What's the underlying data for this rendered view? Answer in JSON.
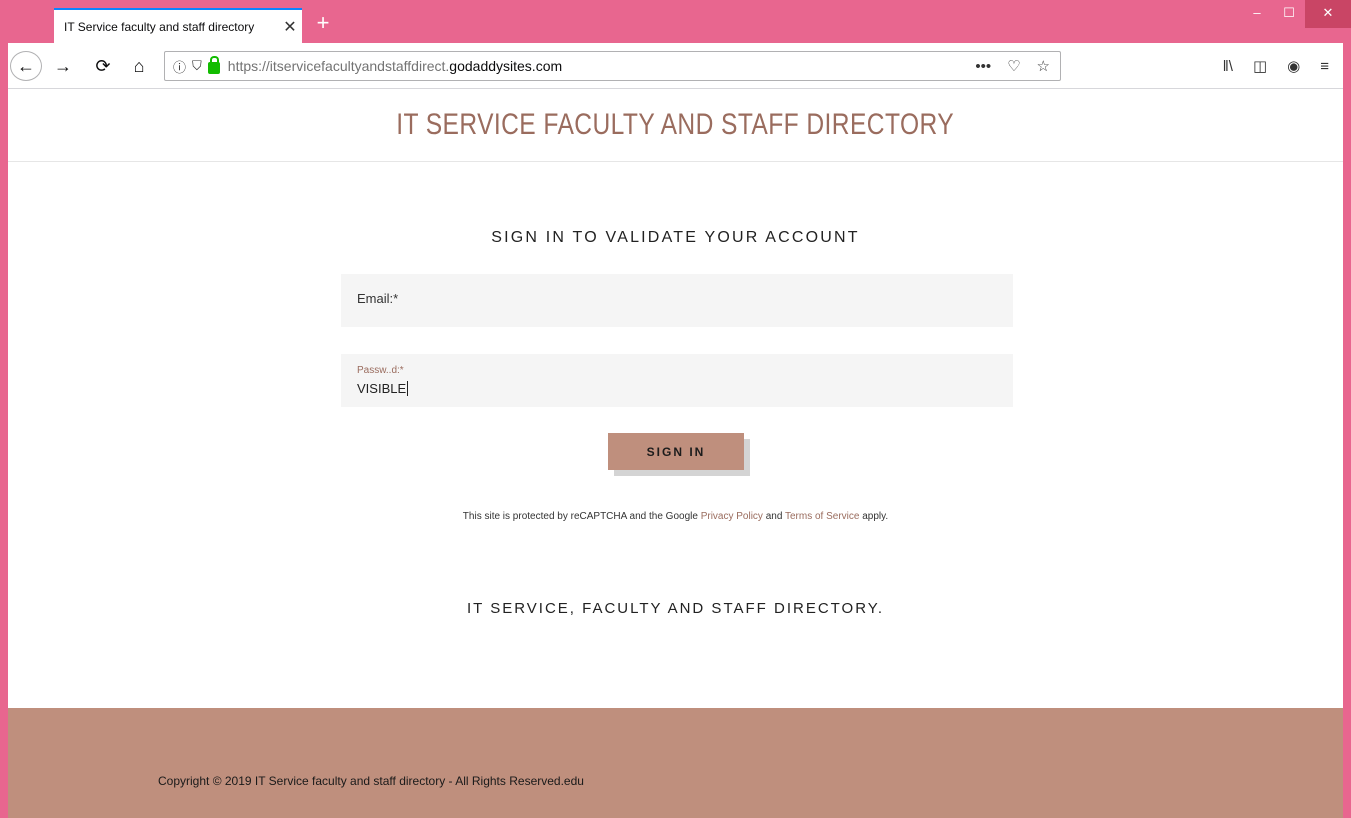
{
  "browser": {
    "tab_title": "IT Service faculty and staff directory",
    "tab_close": "✕",
    "new_tab": "+",
    "url_prefix": "https://itservicefacultyandstaffdirect.",
    "url_domain": "godaddysites.com",
    "window_controls": {
      "minimize": "–",
      "maximize": "☐",
      "close": "✕"
    },
    "nav": {
      "back": "←",
      "forward": "→",
      "reload": "⟳",
      "home": "⌂"
    },
    "url_icons": {
      "info": "ⓘ",
      "shield": "⛉"
    },
    "url_actions": {
      "more": "•••",
      "pocket": "♡",
      "bookmark": "☆"
    },
    "toolbar": {
      "library": "‖\\",
      "sidebar": "◫",
      "account": "◉",
      "menu": "≡"
    }
  },
  "site": {
    "title": "IT SERVICE FACULTY AND STAFF DIRECTORY",
    "form_heading": "SIGN IN TO VALIDATE YOUR ACCOUNT",
    "email_label": "Email:*",
    "password_label": "Passw..d:*",
    "password_value": "VISIBLE",
    "signin_label": "SIGN IN",
    "recaptcha_prefix": "This site is protected by reCAPTCHA and the Google ",
    "privacy_policy": "Privacy Policy",
    "and_text": " and ",
    "terms": "Terms of Service",
    "apply_text": " apply.",
    "tagline": "IT SERVICE, FACULTY AND STAFF DIRECTORY.",
    "copyright": "Copyright © 2019 IT Service faculty and staff directory - All Rights Reserved.edu"
  },
  "colors": {
    "chrome": "#e8668f",
    "accent": "#bf8f7d",
    "title_text": "#9a6c5e"
  }
}
